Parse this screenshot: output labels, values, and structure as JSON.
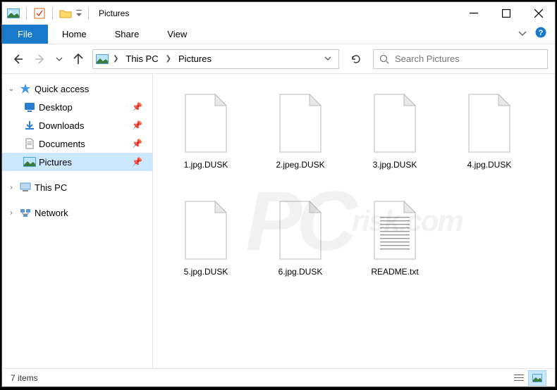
{
  "window": {
    "title": "Pictures"
  },
  "ribbon": {
    "file": "File",
    "tabs": [
      "Home",
      "Share",
      "View"
    ]
  },
  "breadcrumbs": [
    "This PC",
    "Pictures"
  ],
  "search": {
    "placeholder": "Search Pictures"
  },
  "sidebar": {
    "quick_access": "Quick access",
    "items": [
      {
        "label": "Desktop",
        "pinned": true
      },
      {
        "label": "Downloads",
        "pinned": true
      },
      {
        "label": "Documents",
        "pinned": true
      },
      {
        "label": "Pictures",
        "pinned": true,
        "selected": true
      }
    ],
    "this_pc": "This PC",
    "network": "Network"
  },
  "files": [
    {
      "name": "1.jpg.DUSK",
      "type": "blank"
    },
    {
      "name": "2.jpeg.DUSK",
      "type": "blank"
    },
    {
      "name": "3.jpg.DUSK",
      "type": "blank"
    },
    {
      "name": "4.jpg.DUSK",
      "type": "blank"
    },
    {
      "name": "5.jpg.DUSK",
      "type": "blank"
    },
    {
      "name": "6.jpg.DUSK",
      "type": "blank"
    },
    {
      "name": "README.txt",
      "type": "text"
    }
  ],
  "status": {
    "count": "7 items"
  }
}
